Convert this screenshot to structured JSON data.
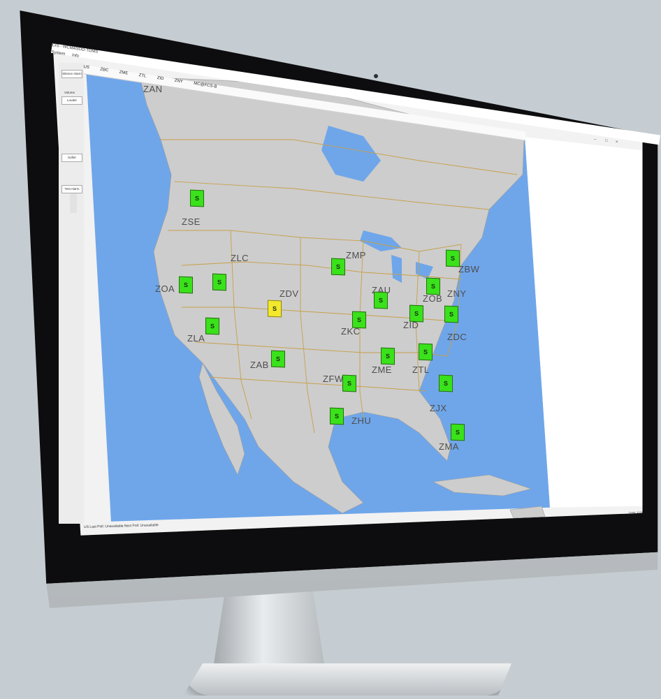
{
  "window": {
    "title": "CIS - WCMASOD-TDMS",
    "menu": [
      "System",
      "Info"
    ]
  },
  "tabs": [
    "US",
    "ZBC",
    "ZME",
    "ZTL",
    "ZID",
    "ZNY",
    "MC@FCS-B"
  ],
  "sidebar": {
    "silence_alarm": "Silence Alarm",
    "volume_label": "Volume",
    "louder": "Louder",
    "softer": "Softer",
    "test_alarm": "Test Alarm"
  },
  "map": {
    "ocean_color": "#6fa6ea",
    "land_color": "#cdcdcd",
    "border_color": "#c7a04a",
    "centers": [
      {
        "name": "ZAN"
      },
      {
        "name": "ZSE"
      },
      {
        "name": "ZLC"
      },
      {
        "name": "ZOA"
      },
      {
        "name": "ZDV"
      },
      {
        "name": "ZMP"
      },
      {
        "name": "ZAU"
      },
      {
        "name": "ZLA"
      },
      {
        "name": "ZKC"
      },
      {
        "name": "ZOB"
      },
      {
        "name": "ZBW"
      },
      {
        "name": "ZNY"
      },
      {
        "name": "ZID"
      },
      {
        "name": "ZDC"
      },
      {
        "name": "ZAB"
      },
      {
        "name": "ZME"
      },
      {
        "name": "ZTL"
      },
      {
        "name": "ZFW"
      },
      {
        "name": "ZJX"
      },
      {
        "name": "ZHU"
      },
      {
        "name": "ZMA"
      }
    ],
    "status_boxes": [
      {
        "center": "ZSE",
        "label": "S",
        "status": "ok",
        "color": "#39e21a"
      },
      {
        "center": "ZOA",
        "label": "S",
        "status": "ok",
        "color": "#39e21a"
      },
      {
        "center": "ZLC",
        "label": "S",
        "status": "ok",
        "color": "#39e21a"
      },
      {
        "center": "ZLA",
        "label": "S",
        "status": "ok",
        "color": "#39e21a"
      },
      {
        "center": "ZDV",
        "label": "S",
        "status": "warning",
        "color": "#f3e82c"
      },
      {
        "center": "ZMP",
        "label": "S",
        "status": "ok",
        "color": "#39e21a"
      },
      {
        "center": "ZAU",
        "label": "S",
        "status": "ok",
        "color": "#39e21a"
      },
      {
        "center": "ZKC",
        "label": "S",
        "status": "ok",
        "color": "#39e21a"
      },
      {
        "center": "ZOB",
        "label": "S",
        "status": "ok",
        "color": "#39e21a"
      },
      {
        "center": "ZBW",
        "label": "S",
        "status": "ok",
        "color": "#39e21a"
      },
      {
        "center": "ZNY",
        "label": "S",
        "status": "ok",
        "color": "#39e21a"
      },
      {
        "center": "ZID",
        "label": "S",
        "status": "ok",
        "color": "#39e21a"
      },
      {
        "center": "ZAB",
        "label": "S",
        "status": "ok",
        "color": "#39e21a"
      },
      {
        "center": "ZME",
        "label": "S",
        "status": "ok",
        "color": "#39e21a"
      },
      {
        "center": "ZTL",
        "label": "S",
        "status": "ok",
        "color": "#39e21a"
      },
      {
        "center": "ZFW",
        "label": "S",
        "status": "ok",
        "color": "#39e21a"
      },
      {
        "center": "ZJX",
        "label": "S",
        "status": "ok",
        "color": "#39e21a"
      },
      {
        "center": "ZHU",
        "label": "S",
        "status": "ok",
        "color": "#39e21a"
      },
      {
        "center": "ZMA",
        "label": "S",
        "status": "ok",
        "color": "#39e21a"
      }
    ]
  },
  "status_bar": {
    "text": "US  Last Poll: Unavailable  Next Poll: Unavailable",
    "right": "Load: 1024"
  },
  "window_controls": {
    "minimize": "–",
    "maximize": "□",
    "close": "×"
  }
}
